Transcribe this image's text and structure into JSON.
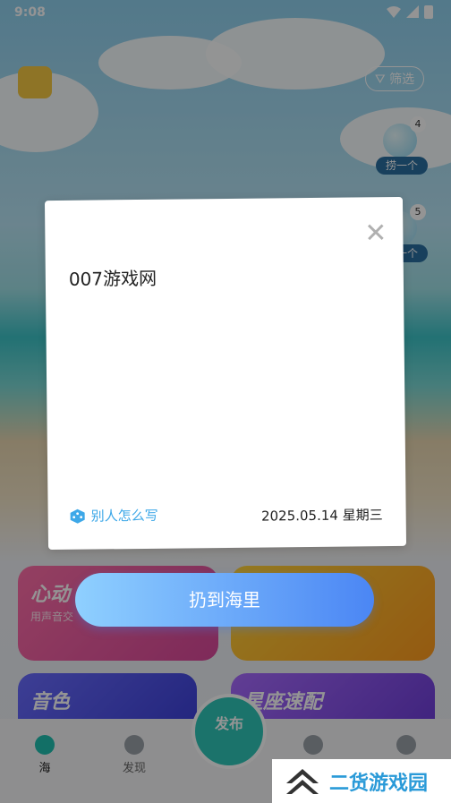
{
  "status_bar": {
    "time": "9:08"
  },
  "top": {
    "filter_label": "筛选"
  },
  "bubbles": [
    {
      "badge": "4",
      "label": "捞一个"
    },
    {
      "badge": "5",
      "label": "捞一个"
    }
  ],
  "cards": [
    {
      "title": "心动",
      "subtitle": "用声音交",
      "colors": [
        "#ff6fa8",
        "#d9489a"
      ]
    },
    {
      "title": "",
      "subtitle": "",
      "colors": [
        "#ffd33a",
        "#ff9b1e"
      ]
    },
    {
      "title": "音色",
      "subtitle": "",
      "colors": [
        "#6a6cff",
        "#3b3fd8"
      ]
    },
    {
      "title": "星座速配",
      "subtitle": "",
      "colors": [
        "#a86bff",
        "#6c3cd8"
      ]
    }
  ],
  "dialog": {
    "content": "007游戏网",
    "others_label": "别人怎么写",
    "date": "2025.05.14 星期三"
  },
  "throw_button": "扔到海里",
  "nav": {
    "items": [
      {
        "label": "海"
      },
      {
        "label": "发现"
      },
      {
        "label": ""
      },
      {
        "label": ""
      }
    ],
    "publish": "发布"
  },
  "watermark": "二货游戏园",
  "colors": {
    "accent": "#3ea8e8",
    "button_start": "#8fd0ff",
    "button_end": "#4b86f4"
  }
}
